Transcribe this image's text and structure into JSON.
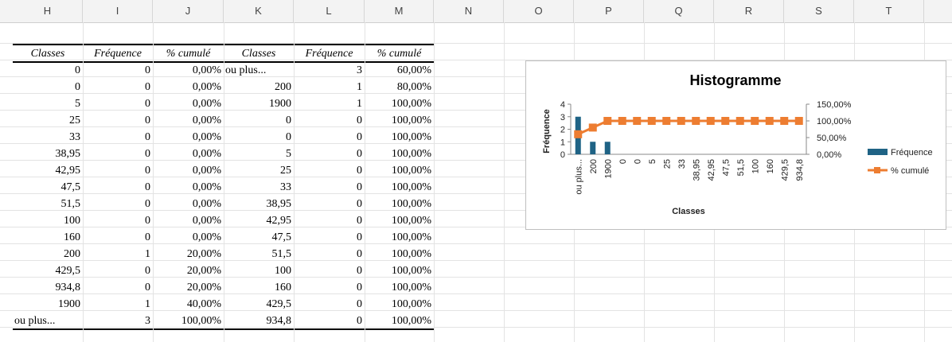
{
  "columns": [
    "H",
    "I",
    "J",
    "K",
    "L",
    "M",
    "N",
    "O",
    "P",
    "Q",
    "R",
    "S",
    "T"
  ],
  "table": {
    "headers": [
      "Classes",
      "Fréquence",
      "% cumulé",
      "Classes",
      "Fréquence",
      "% cumulé"
    ],
    "rows": [
      [
        "0",
        "0",
        "0,00%",
        "ou plus...",
        "3",
        "60,00%"
      ],
      [
        "0",
        "0",
        "0,00%",
        "200",
        "1",
        "80,00%"
      ],
      [
        "5",
        "0",
        "0,00%",
        "1900",
        "1",
        "100,00%"
      ],
      [
        "25",
        "0",
        "0,00%",
        "0",
        "0",
        "100,00%"
      ],
      [
        "33",
        "0",
        "0,00%",
        "0",
        "0",
        "100,00%"
      ],
      [
        "38,95",
        "0",
        "0,00%",
        "5",
        "0",
        "100,00%"
      ],
      [
        "42,95",
        "0",
        "0,00%",
        "25",
        "0",
        "100,00%"
      ],
      [
        "47,5",
        "0",
        "0,00%",
        "33",
        "0",
        "100,00%"
      ],
      [
        "51,5",
        "0",
        "0,00%",
        "38,95",
        "0",
        "100,00%"
      ],
      [
        "100",
        "0",
        "0,00%",
        "42,95",
        "0",
        "100,00%"
      ],
      [
        "160",
        "0",
        "0,00%",
        "47,5",
        "0",
        "100,00%"
      ],
      [
        "200",
        "1",
        "20,00%",
        "51,5",
        "0",
        "100,00%"
      ],
      [
        "429,5",
        "0",
        "20,00%",
        "100",
        "0",
        "100,00%"
      ],
      [
        "934,8",
        "0",
        "20,00%",
        "160",
        "0",
        "100,00%"
      ],
      [
        "1900",
        "1",
        "40,00%",
        "429,5",
        "0",
        "100,00%"
      ],
      [
        "ou plus...",
        "3",
        "100,00%",
        "934,8",
        "0",
        "100,00%"
      ]
    ]
  },
  "chart_data": {
    "type": "bar",
    "title": "Histogramme",
    "xlabel": "Classes",
    "ylabel": "Fréquence",
    "categories": [
      "ou plus...",
      "200",
      "1900",
      "0",
      "0",
      "5",
      "25",
      "33",
      "38,95",
      "42,95",
      "47,5",
      "51,5",
      "100",
      "160",
      "429,5",
      "934,8"
    ],
    "series": [
      {
        "name": "Fréquence",
        "type": "bar",
        "axis": "left",
        "color": "#1f6385",
        "values": [
          3,
          1,
          1,
          0,
          0,
          0,
          0,
          0,
          0,
          0,
          0,
          0,
          0,
          0,
          0,
          0
        ]
      },
      {
        "name": "% cumulé",
        "type": "line",
        "axis": "right",
        "color": "#ed7d31",
        "values": [
          0.6,
          0.8,
          1,
          1,
          1,
          1,
          1,
          1,
          1,
          1,
          1,
          1,
          1,
          1,
          1,
          1
        ]
      }
    ],
    "ylim_left": [
      0,
      4
    ],
    "yticks_left": [
      "0",
      "1",
      "2",
      "3",
      "4"
    ],
    "ylim_right": [
      0,
      1.5
    ],
    "yticks_right": [
      "0,00%",
      "50,00%",
      "100,00%",
      "150,00%"
    ],
    "legend": "right",
    "grid": false
  }
}
